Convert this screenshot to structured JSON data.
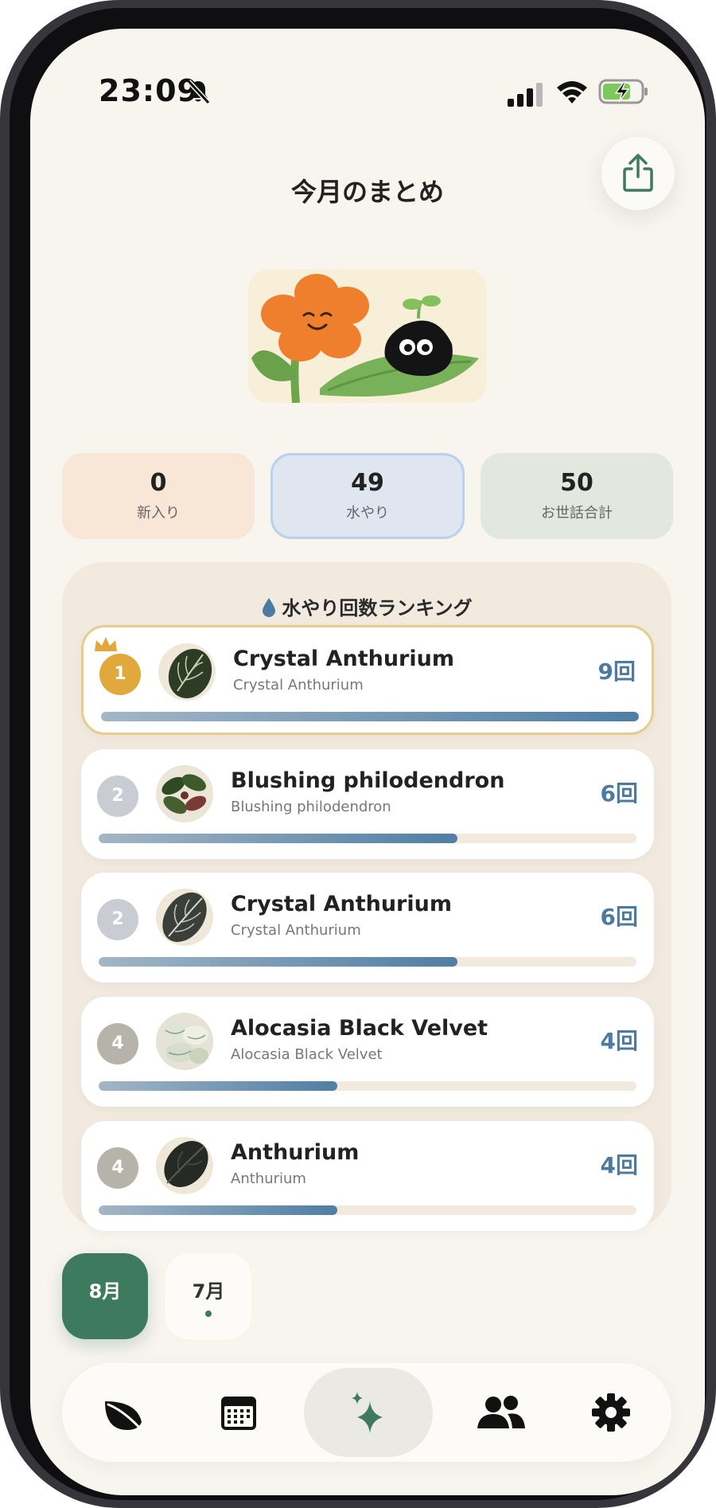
{
  "status_bar": {
    "time": "23:09"
  },
  "header": {
    "title": "今月のまとめ"
  },
  "stats": [
    {
      "value": "0",
      "label": "新入り"
    },
    {
      "value": "49",
      "label": "水やり"
    },
    {
      "value": "50",
      "label": "お世話合計"
    }
  ],
  "ranking": {
    "title": "水やり回数ランキング",
    "items": [
      {
        "rank": "1",
        "name": "Crystal Anthurium",
        "sub": "Crystal Anthurium",
        "count": "9回",
        "progress": 1.0
      },
      {
        "rank": "2",
        "name": "Blushing philodendron",
        "sub": "Blushing philodendron",
        "count": "6回",
        "progress": 0.667
      },
      {
        "rank": "2",
        "name": "Crystal Anthurium",
        "sub": "Crystal Anthurium",
        "count": "6回",
        "progress": 0.667
      },
      {
        "rank": "4",
        "name": "Alocasia Black Velvet",
        "sub": "Alocasia Black Velvet",
        "count": "4回",
        "progress": 0.444
      },
      {
        "rank": "4",
        "name": "Anthurium",
        "sub": "Anthurium",
        "count": "4回",
        "progress": 0.444
      }
    ]
  },
  "months": [
    {
      "label": "8月",
      "active": true
    },
    {
      "label": "7月",
      "active": false,
      "has_dot": true
    }
  ],
  "tabbar": {
    "items": [
      {
        "icon": "leaf-icon"
      },
      {
        "icon": "calendar-icon"
      },
      {
        "icon": "sparkle-icon",
        "active": true
      },
      {
        "icon": "people-icon"
      },
      {
        "icon": "gear-icon"
      }
    ]
  },
  "colors": {
    "background": "#f8f5ee",
    "accent_green": "#3e7a5e",
    "count_blue": "#4d7a9f",
    "gold": "#e1a93b"
  }
}
